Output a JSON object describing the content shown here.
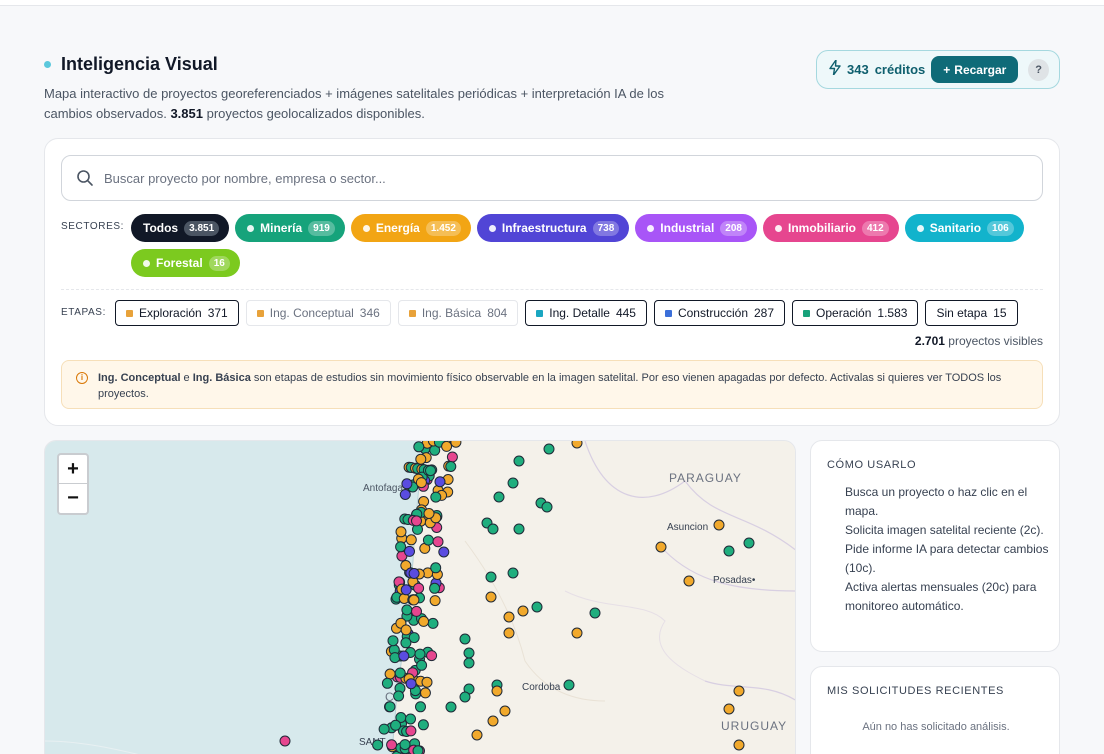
{
  "header": {
    "title": "Inteligencia Visual",
    "subtitle_pre": "Mapa interactivo de proyectos georeferenciados + imágenes satelitales periódicas + interpretación IA de los cambios observados. ",
    "subtitle_count": "3.851",
    "subtitle_post": " proyectos geolocalizados disponibles."
  },
  "credits": {
    "amount": "343",
    "label": "créditos",
    "recharge_label": "Recargar",
    "help": "?"
  },
  "search": {
    "placeholder": "Buscar proyecto por nombre, empresa o sector...",
    "value": ""
  },
  "sectors": {
    "label": "SECTORES:",
    "items": [
      {
        "label": "Todos",
        "count": "3.851",
        "color": "#111827"
      },
      {
        "label": "Minería",
        "count": "919",
        "color": "#16a37b"
      },
      {
        "label": "Energía",
        "count": "1.452",
        "color": "#f2a514"
      },
      {
        "label": "Infraestructura",
        "count": "738",
        "color": "#5145d6"
      },
      {
        "label": "Industrial",
        "count": "208",
        "color": "#a855f7"
      },
      {
        "label": "Inmobiliario",
        "count": "412",
        "color": "#e6468f"
      },
      {
        "label": "Sanitario",
        "count": "106",
        "color": "#12b3cc"
      },
      {
        "label": "Forestal",
        "count": "16",
        "color": "#7cca1f"
      }
    ]
  },
  "stages": {
    "label": "ETAPAS:",
    "items": [
      {
        "label": "Exploración",
        "count": "371",
        "color": "#e8a23a",
        "active": true
      },
      {
        "label": "Ing. Conceptual",
        "count": "346",
        "color": "#e8a23a",
        "active": false
      },
      {
        "label": "Ing. Básica",
        "count": "804",
        "color": "#e8a23a",
        "active": false
      },
      {
        "label": "Ing. Detalle",
        "count": "445",
        "color": "#1aa6c1",
        "active": true
      },
      {
        "label": "Construcción",
        "count": "287",
        "color": "#3b6fd9",
        "active": true
      },
      {
        "label": "Operación",
        "count": "1.583",
        "color": "#18a27b",
        "active": true
      },
      {
        "label": "Sin etapa",
        "count": "15",
        "color": "",
        "active": true
      }
    ]
  },
  "visible": {
    "count": "2.701",
    "label": " proyectos visibles"
  },
  "info": {
    "bold1": "Ing. Conceptual",
    "mid1": " e ",
    "bold2": "Ing. Básica",
    "rest": " son etapas de estudios sin movimiento físico observable en la imagen satelital. Por eso vienen apagadas por defecto. Activalas si quieres ver TODOS los proyectos."
  },
  "map": {
    "zoom_in": "+",
    "zoom_out": "−",
    "labels": {
      "antofagasta": "Antofagasta",
      "paraguay": "PARAGUAY",
      "asuncion": "Asuncion",
      "posadas": "Posadas•",
      "cordoba": "Cordoba",
      "uruguay": "URUGUAY",
      "santiago": "SANT",
      "co": "C"
    }
  },
  "how_to": {
    "title": "CÓMO USARLO",
    "steps": [
      "Busca un proyecto o haz clic en el mapa.",
      "Solicita imagen satelital reciente (2c).",
      "Pide informe IA para detectar cambios (10c).",
      "Activa alertas mensuales (20c) para monitoreo automático."
    ]
  },
  "requests": {
    "title": "MIS SOLICITUDES RECIENTES",
    "empty": "Aún no has solicitado análisis."
  },
  "colors": {
    "accent": "#0f6b78",
    "ocean": "#d7e9ec",
    "land": "#f4f1ea"
  }
}
